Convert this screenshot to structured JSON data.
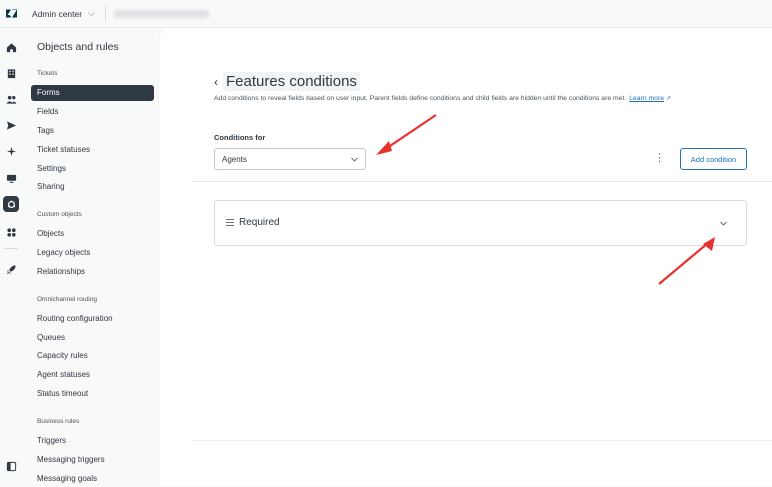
{
  "topbar": {
    "app_title": "Admin center",
    "account_name": "••••••••••••••••"
  },
  "nav": {
    "title": "Objects and rules",
    "sections": [
      {
        "label": "Tickets",
        "items": [
          "Forms",
          "Fields",
          "Tags",
          "Ticket statuses",
          "Settings",
          "Sharing"
        ]
      },
      {
        "label": "Custom objects",
        "items": [
          "Objects",
          "Legacy objects",
          "Relationships"
        ]
      },
      {
        "label": "Omnichannel routing",
        "items": [
          "Routing configuration",
          "Queues",
          "Capacity rules",
          "Agent statuses",
          "Status timeout"
        ]
      },
      {
        "label": "Business rules",
        "items": [
          "Triggers",
          "Messaging triggers",
          "Messaging goals"
        ]
      }
    ],
    "active_item": "Forms"
  },
  "main": {
    "title": "Features conditions",
    "description": "Add conditions to reveal fields based on user input. Parent fields define conditions and child fields are hidden until the conditions are met.",
    "learn_more": "Learn more",
    "conditions_label": "Conditions for",
    "select_value": "Agents",
    "add_condition": "Add condition",
    "accordion_label": "Required"
  },
  "colors": {
    "accent": "#1f73b7",
    "annotation_arrow": "#e8322e",
    "nav_active": "#2f3941"
  },
  "icons": {
    "rail": [
      "home-icon",
      "building-icon",
      "people-icon",
      "send-icon",
      "sparkle-icon",
      "monitor-icon",
      "objects-rules-icon",
      "apps-icon",
      "rocket-icon",
      "panel-toggle-icon"
    ]
  }
}
